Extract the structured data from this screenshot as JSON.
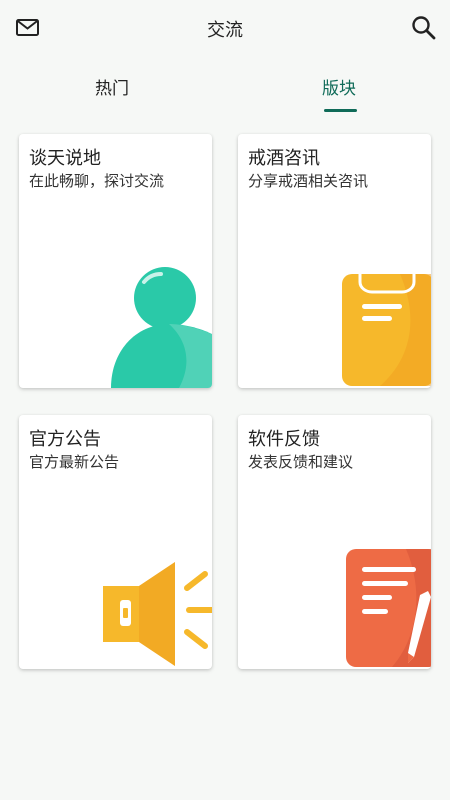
{
  "header": {
    "title": "交流",
    "left_icon": "mail-icon",
    "right_icon": "search-icon"
  },
  "tabs": [
    {
      "label": "热门",
      "active": false
    },
    {
      "label": "版块",
      "active": true
    }
  ],
  "colors": {
    "accent": "#0f6b58",
    "background": "#f6f8f6",
    "teal": "#2ac9a8",
    "yellow": "#f6b82b",
    "orange_red": "#ee6b45"
  },
  "cards": [
    {
      "title": "谈天说地",
      "subtitle": "在此畅聊，探讨交流",
      "icon": "user-icon"
    },
    {
      "title": "戒酒咨讯",
      "subtitle": "分享戒酒相关咨讯",
      "icon": "clipboard-icon"
    },
    {
      "title": "官方公告",
      "subtitle": "官方最新公告",
      "icon": "megaphone-icon"
    },
    {
      "title": "软件反馈",
      "subtitle": "发表反馈和建议",
      "icon": "notepad-pen-icon"
    }
  ]
}
